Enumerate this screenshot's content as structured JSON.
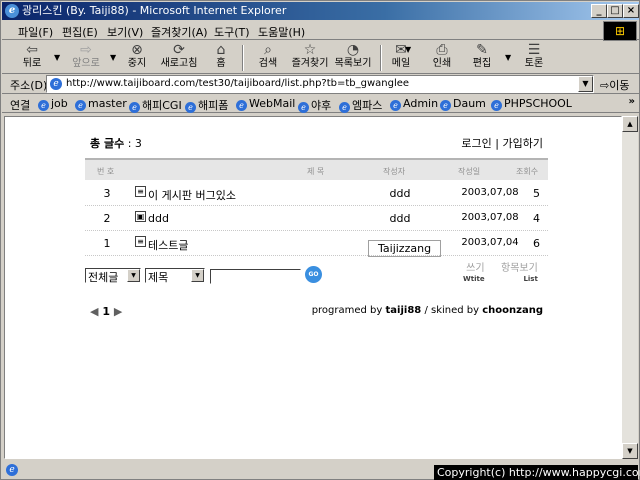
{
  "window": {
    "title": "광리스킨 (By. Taiji88) - Microsoft Internet Explorer",
    "min": "_",
    "max": "□",
    "close": "×"
  },
  "menu": [
    "파일(F)",
    "편집(E)",
    "보기(V)",
    "즐겨찾기(A)",
    "도구(T)",
    "도움말(H)"
  ],
  "toolbar": {
    "back": "뒤로",
    "forward": "앞으로",
    "stop": "중지",
    "refresh": "새로고침",
    "home": "홈",
    "search": "검색",
    "favorites": "즐겨찾기",
    "history": "목록보기",
    "mail": "메일",
    "print": "인쇄",
    "edit": "편집",
    "discuss": "토론"
  },
  "address": {
    "label": "주소(D)",
    "url": "http://www.taijiboard.com/test30/taijiboard/list.php?tb=tb_gwanglee",
    "go": "이동"
  },
  "links": {
    "label": "연결",
    "items": [
      "job",
      "master",
      "해피CGI",
      "해피폼",
      "WebMail",
      "야후",
      "엠파스",
      "Admin",
      "Daum",
      "PHPSCHOOL"
    ]
  },
  "board": {
    "total_label": "총 글수",
    "total_value": ": 3",
    "login": "로그인",
    "signup": "가입하기",
    "sep": "|",
    "columns": {
      "num": "번 호",
      "subject": "제 목",
      "author": "작성자",
      "date": "작성일",
      "hits": "조회수"
    },
    "rows": [
      {
        "num": "3",
        "subject": "이 게시판 버그있소",
        "author": "ddd",
        "date": "2003,07,08",
        "hits": "5"
      },
      {
        "num": "2",
        "subject": "ddd",
        "author": "ddd",
        "date": "2003,07,08",
        "hits": "4"
      },
      {
        "num": "1",
        "subject": "테스트글",
        "author": "Taijizzang",
        "date": "2003,07,04",
        "hits": "6"
      }
    ],
    "filter_select": "전체글",
    "field_select": "제목",
    "search_value": "",
    "go_label": "GO",
    "write_ko": "쓰기",
    "write_en": "Wtite",
    "list_ko": "항목보기",
    "list_en": "List",
    "page": "1",
    "credit_prefix": "programed by",
    "credit_author": "taiji88",
    "credit_mid": "/ skined by",
    "credit_skin": "choonzang"
  },
  "copyright": "Copyright(c) http://www.happycgi.com"
}
